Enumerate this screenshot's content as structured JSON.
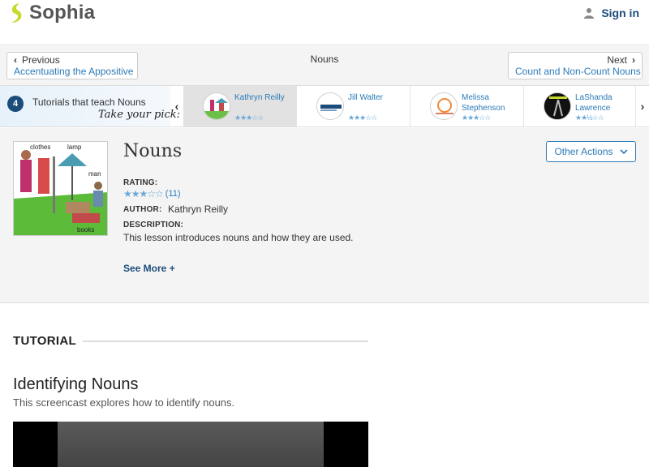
{
  "header": {
    "logo_text": "Sophia",
    "signin_label": "Sign in",
    "brand_color": "#c6d92c"
  },
  "navbar": {
    "prev_dir": "Previous",
    "prev_title": "Accentuating the Appositive",
    "center_title": "Nouns",
    "next_dir": "Next",
    "next_title": "Count and Non-Count Nouns"
  },
  "picker": {
    "count": "4",
    "label": "Tutorials that teach Nouns",
    "tagline": "Take your pick:",
    "authors": [
      {
        "name": "Kathryn Reilly",
        "rating": 3,
        "active": true
      },
      {
        "name": "Jill Walter",
        "rating": 3,
        "active": false
      },
      {
        "name": "Melissa Stephenson",
        "rating": 3,
        "active": false
      },
      {
        "name": "LaShanda Lawrence",
        "rating": 2.5,
        "active": false
      }
    ]
  },
  "lesson": {
    "title": "Nouns",
    "other_actions": "Other Actions",
    "rating_label": "RATING:",
    "rating_stars": 3,
    "rating_count": "(11)",
    "author_label": "AUTHOR:",
    "author_value": "Kathryn Reilly",
    "description_label": "DESCRIPTION:",
    "description": "This lesson introduces nouns and how they are used.",
    "see_more": "See More +",
    "thumb_words": [
      "clothes",
      "lamp",
      "man",
      "books"
    ]
  },
  "tutorial": {
    "section_label": "TUTORIAL",
    "title": "Identifying Nouns",
    "description": "This screencast explores how to identify nouns."
  }
}
